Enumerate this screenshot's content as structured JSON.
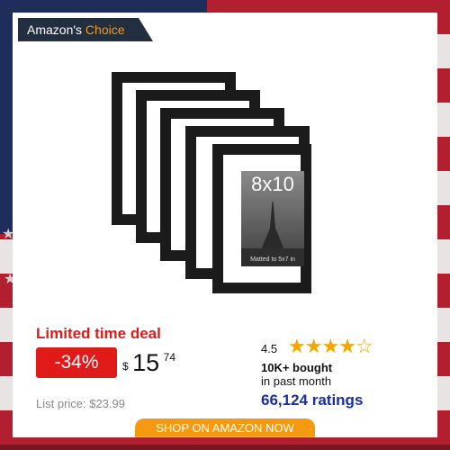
{
  "badge": {
    "prefix": "Amazon's",
    "accent": "Choice"
  },
  "product": {
    "print_label": "8x10",
    "print_caption": "Matted to 5x7 in"
  },
  "deal": {
    "title": "Limited time deal",
    "discount": "-34%",
    "currency": "$",
    "price_main": "15",
    "price_fraction": "74",
    "list_price": "List price: $23.99"
  },
  "rating": {
    "value": "4.5",
    "stars": 4.5,
    "bought": "10K+ bought",
    "bought_sub": "in past month",
    "count": "66,124 ratings"
  },
  "cta": {
    "label": "SHOP ON AMAZON NOW"
  },
  "colors": {
    "deal_red": "#e01919",
    "star_orange": "#f5a500",
    "ratings_blue": "#1a2f9e",
    "cta_orange": "#f59a10",
    "badge_dark": "#232f3e",
    "badge_accent": "#f29b18"
  }
}
